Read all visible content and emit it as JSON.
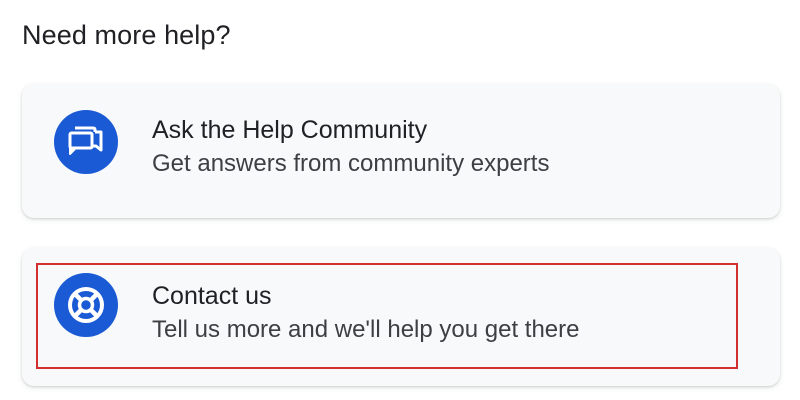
{
  "heading": "Need more help?",
  "cards": [
    {
      "title": "Ask the Help Community",
      "subtitle": "Get answers from community experts",
      "icon": "forum-chat-icon"
    },
    {
      "title": "Contact us",
      "subtitle": "Tell us more and we'll help you get there",
      "icon": "lifebuoy-support-icon"
    }
  ],
  "colors": {
    "icon_background": "#1a5ad4",
    "card_background": "#f8f9fa",
    "highlight_border": "#d32f2f"
  }
}
